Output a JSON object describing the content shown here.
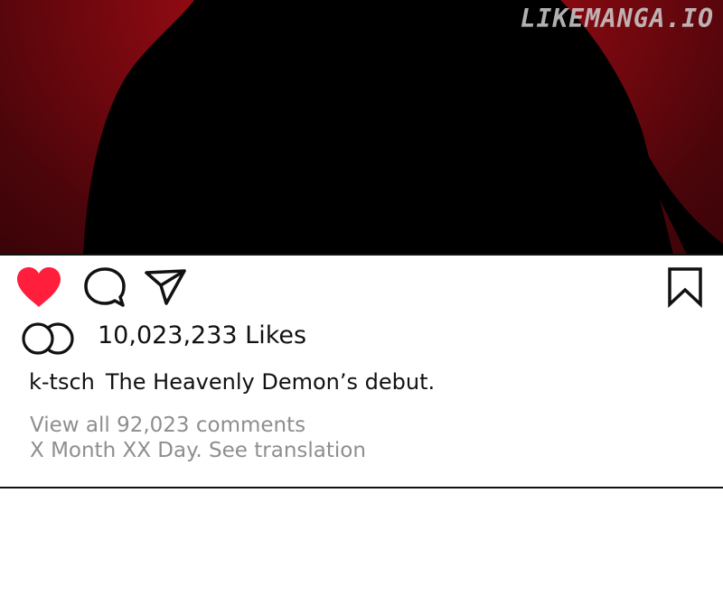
{
  "watermark": "LIKEMANGA.IO",
  "post": {
    "likes_text": "10,023,233 Likes",
    "username": "k-tsch",
    "caption": "The Heavenly Demon’s debut.",
    "comments_link": "View all 92,023 comments",
    "date_line": "X Month XX Day. See translation"
  },
  "icons": {
    "like": "heart-icon",
    "comment": "comment-bubble-icon",
    "share": "paper-plane-icon",
    "save": "bookmark-icon",
    "likers": "liker-avatars-icon"
  },
  "colors": {
    "liked_heart": "#ff1f3d",
    "muted_text": "#8e8e8e",
    "image_red": "#8c0a12"
  }
}
